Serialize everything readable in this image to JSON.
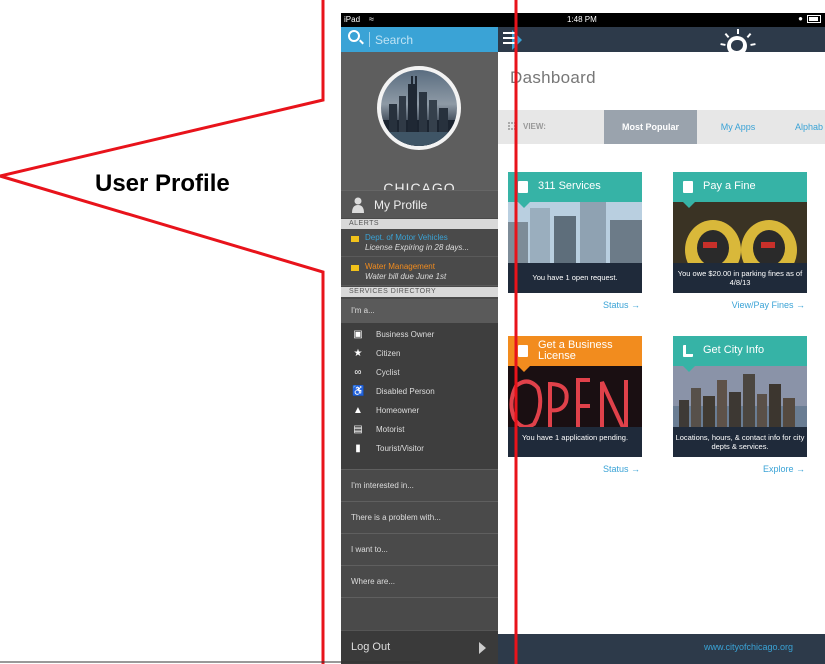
{
  "statusbar": {
    "device": "iPad",
    "time": "1:48 PM"
  },
  "search": {
    "placeholder": "Search"
  },
  "profile": {
    "city": "CHICAGO",
    "my_profile_label": "My Profile"
  },
  "alerts": {
    "heading": "ALERTS",
    "items": [
      {
        "title": "Dept. of Motor Vehicles",
        "detail": "License Expiring in 28 days...",
        "title_color": "#3aa3d6"
      },
      {
        "title": "Water Management",
        "detail": "Water bill due June 1st",
        "title_color": "#f28c1e"
      }
    ]
  },
  "services": {
    "heading": "SERVICES DIRECTORY",
    "im_a": "I'm a...",
    "roles": [
      {
        "label": "Business Owner",
        "icon": "briefcase-icon"
      },
      {
        "label": "Citizen",
        "icon": "star-icon"
      },
      {
        "label": "Cyclist",
        "icon": "bicycle-icon"
      },
      {
        "label": "Disabled Person",
        "icon": "wheelchair-icon"
      },
      {
        "label": "Homeowner",
        "icon": "house-icon"
      },
      {
        "label": "Motorist",
        "icon": "car-icon"
      },
      {
        "label": "Tourist/Visitor",
        "icon": "map-icon"
      }
    ],
    "menu": [
      "I'm interested in...",
      "There is a problem with...",
      "I want to...",
      "Where are..."
    ]
  },
  "logout_label": "Log Out",
  "main": {
    "title": "Dashboard",
    "view_label": "VIEW:",
    "tabs": [
      "Most Popular",
      "My Apps",
      "Alphab"
    ],
    "active_tab": "Most Popular"
  },
  "cards": [
    {
      "title": "311 Services",
      "caption": "You have 1 open request.",
      "link": "Status →",
      "color": "#36b3a6"
    },
    {
      "title": "Pay a Fine",
      "caption": "You owe $20.00 in parking fines as of 4/8/13",
      "link": "View/Pay Fines →",
      "color": "#36b3a6"
    },
    {
      "title": "Get a Business License",
      "caption": "You have 1 application pending.",
      "link": "Status →",
      "color": "#f28c1e"
    },
    {
      "title": "Get City Info",
      "caption": "Locations, hours, & contact info for city depts & services.",
      "link": "Explore →",
      "color": "#36b3a6"
    }
  ],
  "footer_url": "www.cityofchicago.org",
  "annotation": {
    "label": "User Profile",
    "color": "#e8131b"
  },
  "colors": {
    "accent_blue": "#3aa3d6",
    "teal": "#36b3a6",
    "orange": "#f28c1e",
    "navy": "#2d3a4a"
  }
}
